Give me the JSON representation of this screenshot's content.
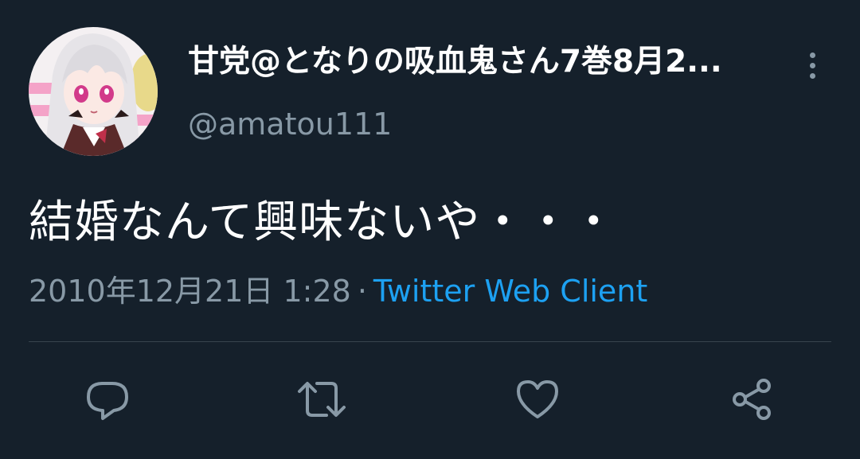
{
  "tweet": {
    "display_name": "甘党@となりの吸血鬼さん7巻8月2...",
    "handle": "@amatou111",
    "text": "結婚なんて興味ないや・・・",
    "timestamp": "2010年12月21日 1:28",
    "separator": "·",
    "source": "Twitter Web Client"
  },
  "actions": [
    {
      "name": "reply",
      "icon": "reply-icon"
    },
    {
      "name": "retweet",
      "icon": "retweet-icon"
    },
    {
      "name": "like",
      "icon": "heart-icon"
    },
    {
      "name": "share",
      "icon": "share-icon"
    }
  ],
  "colors": {
    "background": "#15202b",
    "secondary_text": "#8899a6",
    "link": "#1da1f2",
    "divider": "#38444d"
  }
}
